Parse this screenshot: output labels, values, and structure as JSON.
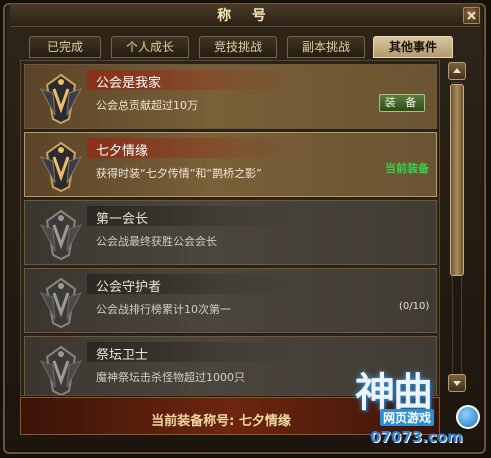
{
  "window": {
    "title": "称 号"
  },
  "tabs": [
    {
      "label": "已完成",
      "active": false
    },
    {
      "label": "个人成长",
      "active": false
    },
    {
      "label": "竞技挑战",
      "active": false
    },
    {
      "label": "副本挑战",
      "active": false
    },
    {
      "label": "其他事件",
      "active": true
    }
  ],
  "titles": [
    {
      "name": "公会是我家",
      "description": "公会总贡献超过10万",
      "action": "装 备",
      "state": "owned"
    },
    {
      "name": "七夕情缘",
      "description": "获得时装“七夕传情”和“鹊桥之影”",
      "status": "当前装备",
      "state": "equipped"
    },
    {
      "name": "第一会长",
      "description": "公会战最终获胜公会会长",
      "state": "locked"
    },
    {
      "name": "公会守护者",
      "description": "公会战排行榜累计10次第一",
      "progress": "(0/10)",
      "state": "locked"
    },
    {
      "name": "祭坛卫士",
      "description": "魔神祭坛击杀怪物超过1000只",
      "state": "locked"
    }
  ],
  "footer": {
    "label": "当前装备称号:",
    "value": "七夕情缘"
  },
  "watermark": {
    "logo": "神曲",
    "subtitle": "网页游戏",
    "url": "07073.com"
  },
  "colors": {
    "gold_text": "#f3e3b6",
    "equipped_status": "#36d24a",
    "equip_button": "#5b7f3a"
  },
  "icons": [
    "close-icon",
    "title-emblem-icon",
    "scroll-up-arrow-icon",
    "scroll-down-arrow-icon"
  ]
}
